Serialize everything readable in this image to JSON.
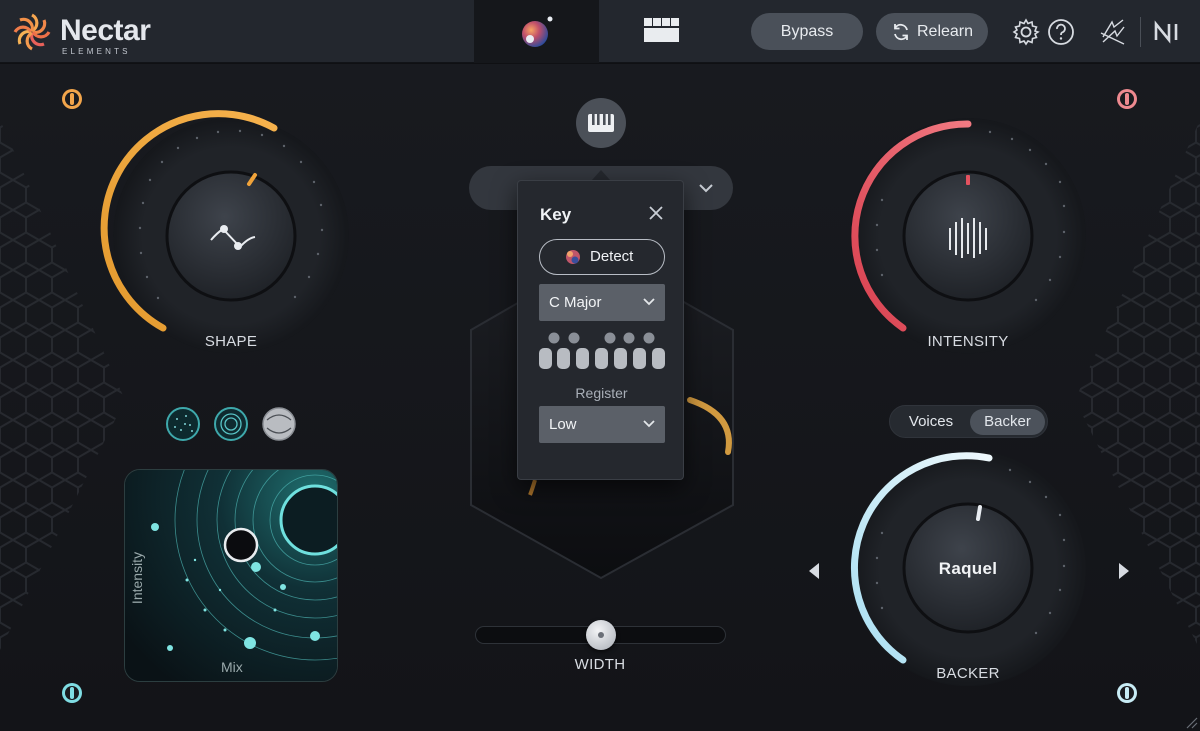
{
  "app": {
    "name": "Nectar",
    "subtitle": "ELEMENTS"
  },
  "header": {
    "tabs": [
      {
        "id": "assistant",
        "icon": "orb-icon",
        "active": true
      },
      {
        "id": "modules",
        "icon": "grid-icon",
        "active": false
      }
    ],
    "bypass_label": "Bypass",
    "relearn_label": "Relearn",
    "icons": [
      "settings-icon",
      "help-icon",
      "izotope-icon",
      "ni-icon"
    ]
  },
  "shape_knob": {
    "label": "SHAPE",
    "value_fraction": 0.55
  },
  "intensity_knob": {
    "label": "INTENSITY",
    "value_fraction": 0.5
  },
  "backer_knob": {
    "label": "BACKER",
    "value": "Raquel",
    "value_fraction": 0.5
  },
  "voices_toggle": {
    "options": [
      "Voices",
      "Backer"
    ],
    "selected": "Backer"
  },
  "style_buttons": [
    "sparkle-style-icon",
    "rings-style-icon",
    "metal-style-icon"
  ],
  "mixpad": {
    "y_label": "Intensity",
    "x_label": "Mix"
  },
  "width_slider": {
    "label": "WIDTH",
    "value_fraction": 0.5
  },
  "key_popup": {
    "title": "Key",
    "detect_label": "Detect",
    "key_value": "C Major",
    "register_label": "Register",
    "register_value": "Low"
  },
  "colors": {
    "accent_orange": "#f0a33a",
    "accent_red": "#e4525f",
    "accent_ice": "#cfe8f5",
    "accent_teal": "#5fd8d6"
  }
}
